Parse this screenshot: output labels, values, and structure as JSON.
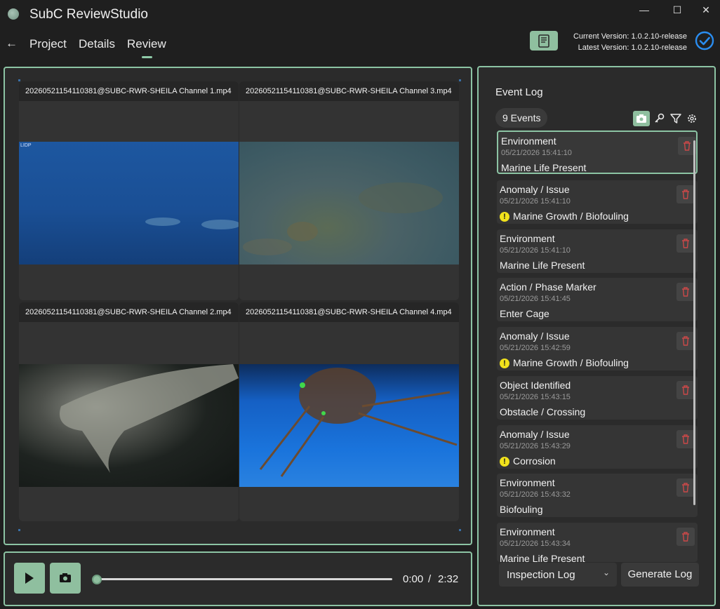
{
  "app": {
    "title": "SubC ReviewStudio"
  },
  "window": {
    "minimize": "—",
    "maximize": "☐",
    "close": "✕"
  },
  "nav": {
    "back": "←",
    "tabs": [
      {
        "label": "Project"
      },
      {
        "label": "Details"
      },
      {
        "label": "Review",
        "active": true
      }
    ]
  },
  "version": {
    "current": "Current Version: 1.0.2.10-release",
    "latest": "Latest Version: 1.0.2.10-release"
  },
  "videos": [
    {
      "title": "20260521154110381@SUBC-RWR-SHEILA Channel 1.mp4",
      "osd": "LIDP"
    },
    {
      "title": "20260521154110381@SUBC-RWR-SHEILA Channel 3.mp4"
    },
    {
      "title": "20260521154110381@SUBC-RWR-SHEILA Channel 2.mp4"
    },
    {
      "title": "20260521154110381@SUBC-RWR-SHEILA Channel 4.mp4"
    }
  ],
  "playback": {
    "current_time": "0:00",
    "separator": "/",
    "duration": "2:32",
    "progress": 0.0
  },
  "event_log": {
    "title": "Event Log",
    "count": "9  Events",
    "events": [
      {
        "category": "Environment",
        "timestamp": "05/21/2026 15:41:10",
        "note": "Marine Life Present",
        "warning": false,
        "selected": true
      },
      {
        "category": "Anomaly / Issue",
        "timestamp": "05/21/2026 15:41:10",
        "note": "Marine Growth / Biofouling",
        "warning": true
      },
      {
        "category": "Environment",
        "timestamp": "05/21/2026 15:41:10",
        "note": "Marine Life Present",
        "warning": false
      },
      {
        "category": "Action / Phase Marker",
        "timestamp": "05/21/2026 15:41:45",
        "note": "Enter Cage",
        "warning": false
      },
      {
        "category": "Anomaly / Issue",
        "timestamp": "05/21/2026 15:42:59",
        "note": "Marine Growth / Biofouling",
        "warning": true
      },
      {
        "category": "Object Identified",
        "timestamp": "05/21/2026 15:43:15",
        "note": "Obstacle / Crossing",
        "warning": false
      },
      {
        "category": "Anomaly / Issue",
        "timestamp": "05/21/2026 15:43:29",
        "note": "Corrosion",
        "warning": true
      },
      {
        "category": "Environment",
        "timestamp": "05/21/2026 15:43:32",
        "note": "Biofouling",
        "warning": false
      },
      {
        "category": "Environment",
        "timestamp": "05/21/2026 15:43:34",
        "note": "Marine Life Present",
        "warning": false
      }
    ],
    "log_type": "Inspection Log",
    "generate": "Generate Log"
  },
  "colors": {
    "accent": "#8cc4a4",
    "button": "#8fbf9f",
    "warning": "#f1e21c",
    "delete": "#c94848"
  }
}
